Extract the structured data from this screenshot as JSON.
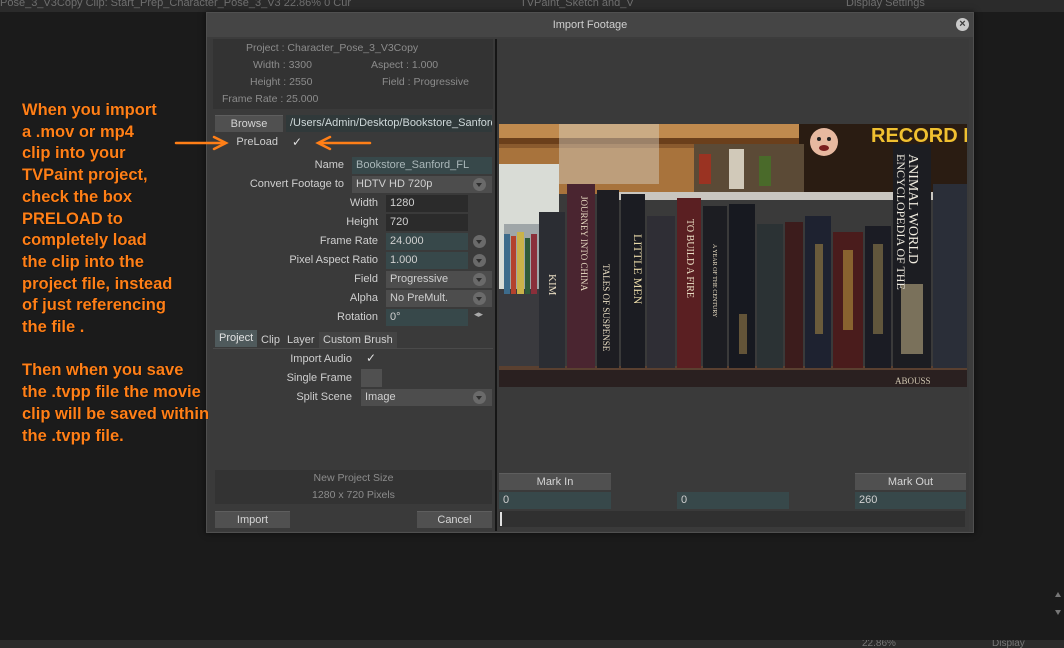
{
  "background": {
    "title_text": "Pose_3_V3Copy    Clip: Start_Prep_Character_Pose_3_V3    22.86%    0    Cur",
    "tab_text": "TVPaint_Sketch and_V",
    "display_settings": "Display Settings",
    "bottom_zoom": "22.86%",
    "bottom_display": "Display"
  },
  "dialog": {
    "title": "Import Footage",
    "close_icon": "close-icon",
    "project_info": {
      "project": "Project : Character_Pose_3_V3Copy",
      "width": "Width : 3300",
      "aspect": "Aspect : 1.000",
      "height": "Height : 2550",
      "field": "Field : Progressive",
      "frame_rate": "Frame Rate : 25.000"
    },
    "browse_label": "Browse",
    "path_value": "/Users/Admin/Desktop/Bookstore_Sanford",
    "preload_label": "PreLoad",
    "preload_checked": "✓",
    "form": {
      "name_label": "Name",
      "name_value": "Bookstore_Sanford_FL",
      "convert_label": "Convert Footage to",
      "convert_value": "HDTV  HD 720p",
      "width_label": "Width",
      "width_value": "1280",
      "height_label": "Height",
      "height_value": "720",
      "frame_rate_label": "Frame Rate",
      "frame_rate_value": "24.000",
      "par_label": "Pixel Aspect Ratio",
      "par_value": "1.000",
      "field_label": "Field",
      "field_value": "Progressive",
      "alpha_label": "Alpha",
      "alpha_value": "No PreMult.",
      "rotation_label": "Rotation",
      "rotation_value": "0°"
    },
    "tabs": [
      "Project",
      "Clip",
      "Layer",
      "Custom Brush"
    ],
    "import_audio_label": "Import Audio",
    "import_audio_checked": "✓",
    "single_frame_label": "Single Frame",
    "split_scene_label": "Split Scene",
    "split_scene_value": "Image",
    "new_project_size_title": "New Project Size",
    "new_project_size_value": "1280 x 720 Pixels",
    "import_button": "Import",
    "cancel_button": "Cancel",
    "mark_in_label": "Mark In",
    "mark_out_label": "Mark Out",
    "mark_in_value": "0",
    "current_value": "0",
    "mark_out_value": "260"
  },
  "preview_text": {
    "record_sign": "RECORD LO",
    "book_encyclopedia": "ENCYCLOPEDIA OF THE",
    "book_animal_world": "ANIMAL WORLD",
    "book_journey": "JOURNEY INTO CHINA",
    "book_suspense": "TALES OF SUSPENSE",
    "book_little_men": "LITTLE MEN",
    "book_kim": "KIM",
    "book_build_fire": "TO BUILD A FIRE",
    "book_year": "A YEAR OF THE CENTURY",
    "book_abouss": "ABOUSS"
  },
  "annotation": {
    "text": "When you import\na .mov or mp4\nclip into your\nTVPaint project,\ncheck the box\nPRELOAD to\ncompletely load\nthe clip into the\nproject file, instead\nof just referencing\nthe file .\n\nThen when you save\nthe .tvpp file the movie\nclip will be saved within\nthe .tvpp file.",
    "color": "#ff7f17"
  },
  "colors": {
    "dialog_bg": "#3c3c3c",
    "field_teal": "#37484a",
    "annotation_orange": "#ff7f17"
  }
}
